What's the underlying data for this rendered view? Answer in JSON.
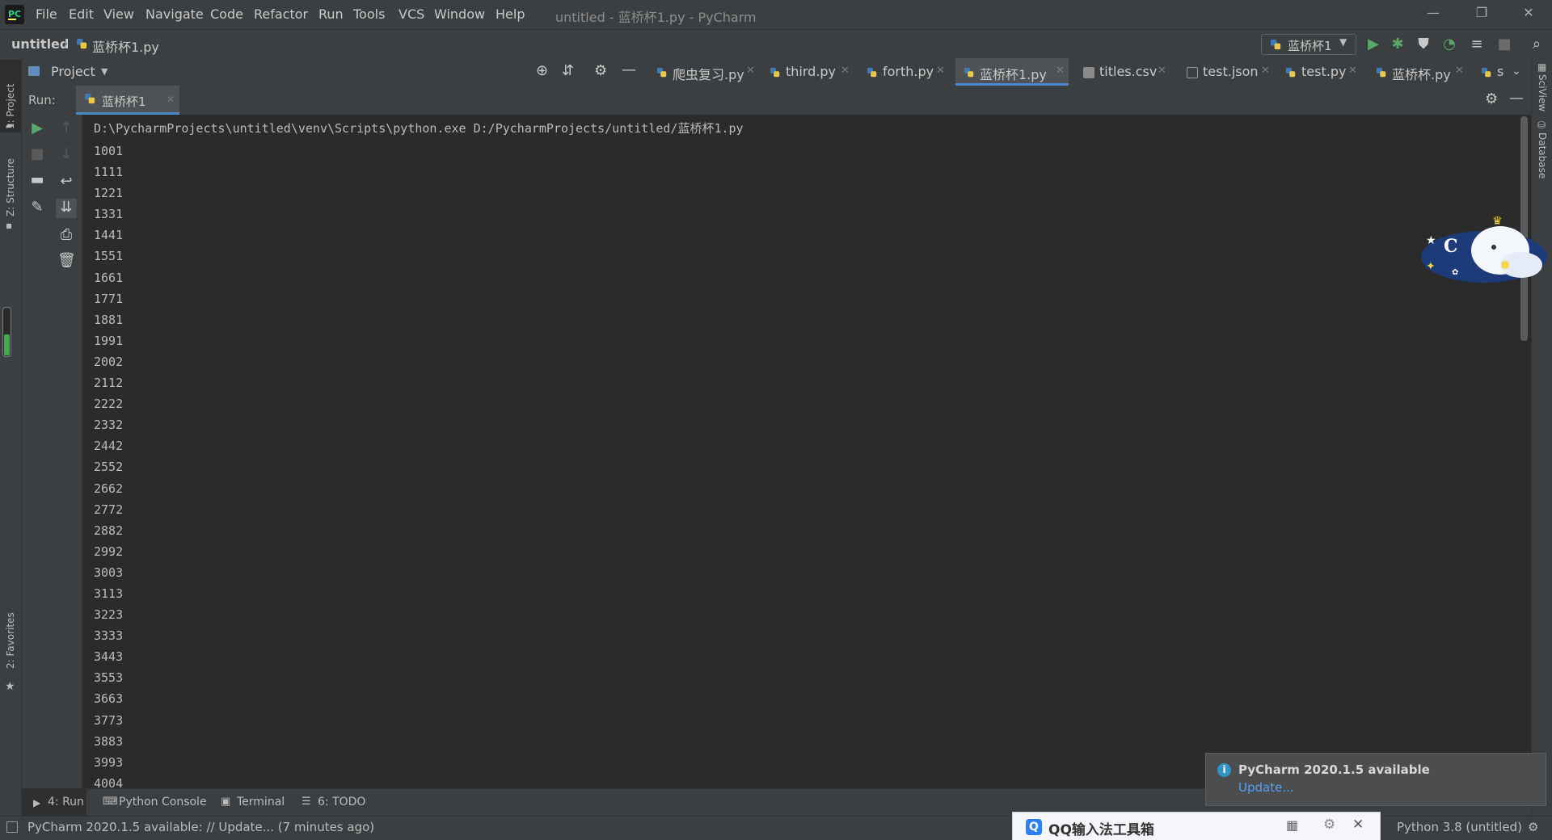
{
  "window": {
    "title": "untitled - 蓝桥杯1.py - PyCharm",
    "menu": [
      "File",
      "Edit",
      "View",
      "Navigate",
      "Code",
      "Refactor",
      "Run",
      "Tools",
      "VCS",
      "Window",
      "Help"
    ],
    "controls": {
      "minimize": "—",
      "restore": "❐",
      "close": "✕"
    }
  },
  "navbar": {
    "project": "untitled",
    "file": "蓝桥杯1.py",
    "run_config": "蓝桥杯1"
  },
  "left_stripe": {
    "project": "1: Project",
    "structure": "Z: Structure",
    "favorites": "2: Favorites"
  },
  "right_stripe": {
    "sciview": "SciView",
    "database": "Database"
  },
  "project_panel": {
    "title": "Project"
  },
  "editor_tabs": [
    {
      "label": "爬虫复习.py",
      "icon": "python-file-icon"
    },
    {
      "label": "third.py",
      "icon": "python-file-icon"
    },
    {
      "label": "forth.py",
      "icon": "python-file-icon"
    },
    {
      "label": "蓝桥杯1.py",
      "icon": "python-file-icon",
      "active": true
    },
    {
      "label": "titles.csv",
      "icon": "text-file-icon"
    },
    {
      "label": "test.json",
      "icon": "json-file-icon"
    },
    {
      "label": "test.py",
      "icon": "python-file-icon"
    },
    {
      "label": "蓝桥杯.py",
      "icon": "python-file-icon"
    },
    {
      "label": "s",
      "icon": "python-file-icon"
    }
  ],
  "run_panel": {
    "label": "Run:",
    "tab": "蓝桥杯1",
    "command": "D:\\PycharmProjects\\untitled\\venv\\Scripts\\python.exe D:/PycharmProjects/untitled/蓝桥杯1.py",
    "output": [
      "1001",
      "1111",
      "1221",
      "1331",
      "1441",
      "1551",
      "1661",
      "1771",
      "1881",
      "1991",
      "2002",
      "2112",
      "2222",
      "2332",
      "2442",
      "2552",
      "2662",
      "2772",
      "2882",
      "2992",
      "3003",
      "3113",
      "3223",
      "3333",
      "3443",
      "3553",
      "3663",
      "3773",
      "3883",
      "3993",
      "4004"
    ]
  },
  "bottom_tabs": [
    "4: Run",
    "Python Console",
    "Terminal",
    "6: TODO"
  ],
  "notification": {
    "title": "PyCharm 2020.1.5 available",
    "link": "Update..."
  },
  "statusbar": {
    "message": "PyCharm 2020.1.5 available: // Update... (7 minutes ago)",
    "interpreter": "Python 3.8 (untitled)"
  },
  "ime": {
    "label": "QQ输入法工具箱"
  },
  "colors": {
    "accent": "#4a88c7",
    "run_green": "#59a869",
    "link": "#589df6"
  }
}
